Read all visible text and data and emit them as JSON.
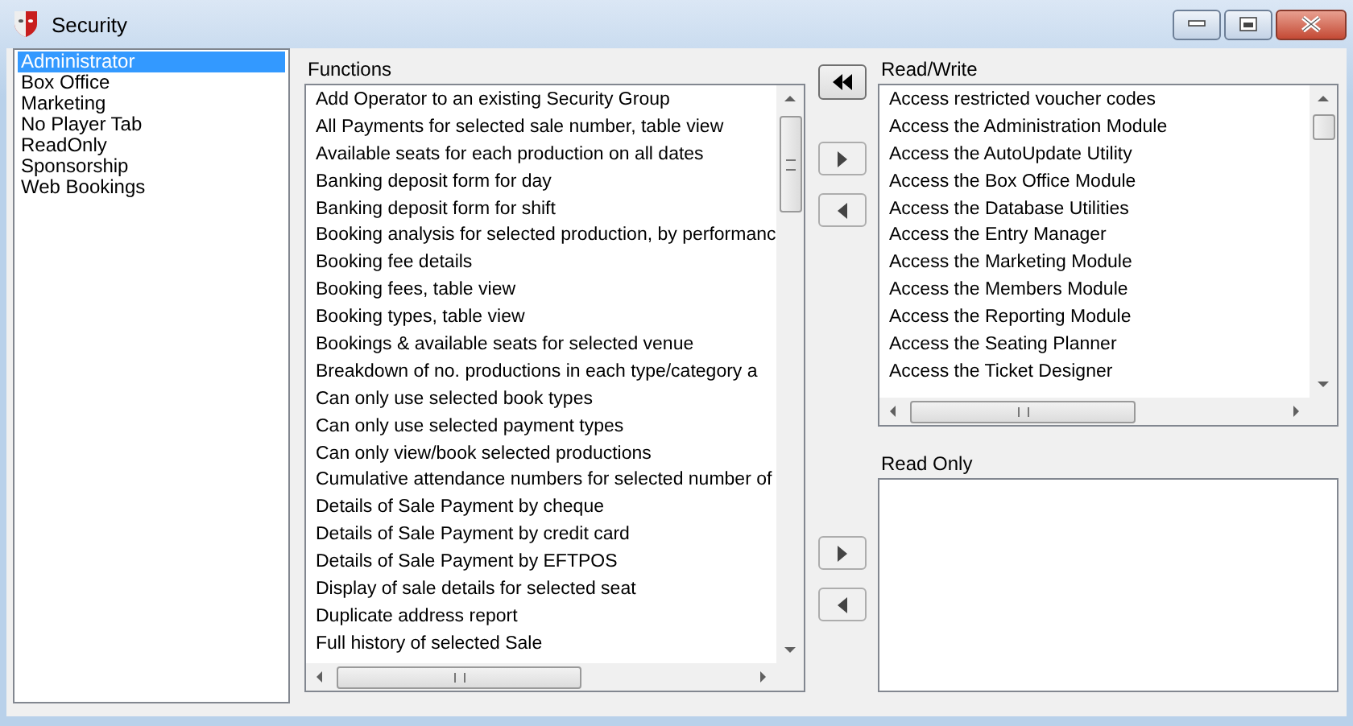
{
  "window": {
    "title": "Security"
  },
  "groups": [
    {
      "label": "Administrator",
      "selected": true
    },
    {
      "label": "Box Office",
      "selected": false
    },
    {
      "label": "Marketing",
      "selected": false
    },
    {
      "label": "No Player Tab",
      "selected": false
    },
    {
      "label": "ReadOnly",
      "selected": false
    },
    {
      "label": "Sponsorship",
      "selected": false
    },
    {
      "label": "Web Bookings",
      "selected": false
    }
  ],
  "functions": {
    "label": "Functions",
    "items": [
      "Add Operator to an existing Security Group",
      "All Payments for selected sale number, table view",
      "Available seats for each production on all dates",
      "Banking deposit form for day",
      "Banking deposit form for shift",
      "Booking analysis for selected production, by performanc",
      "Booking fee details",
      "Booking fees, table view",
      "Booking types, table view",
      "Bookings & available seats for selected venue",
      "Breakdown of no. productions in each type/category a",
      "Can only use selected book types",
      "Can only use selected payment types",
      "Can only view/book selected productions",
      "Cumulative attendance numbers for selected number of",
      "Details of Sale Payment by cheque",
      "Details of Sale Payment by credit card",
      "Details of Sale Payment by EFTPOS",
      "Display of sale details for selected seat",
      "Duplicate address report",
      "Full history of selected Sale"
    ]
  },
  "read_write": {
    "label": "Read/Write",
    "items": [
      "Access restricted voucher codes",
      "Access the Administration Module",
      "Access the AutoUpdate Utility",
      "Access the Box Office Module",
      "Access the Database Utilities",
      "Access the Entry Manager",
      "Access the Marketing Module",
      "Access the Members Module",
      "Access the Reporting Module",
      "Access the Seating Planner",
      "Access the Ticket Designer"
    ]
  },
  "read_only": {
    "label": "Read Only"
  }
}
